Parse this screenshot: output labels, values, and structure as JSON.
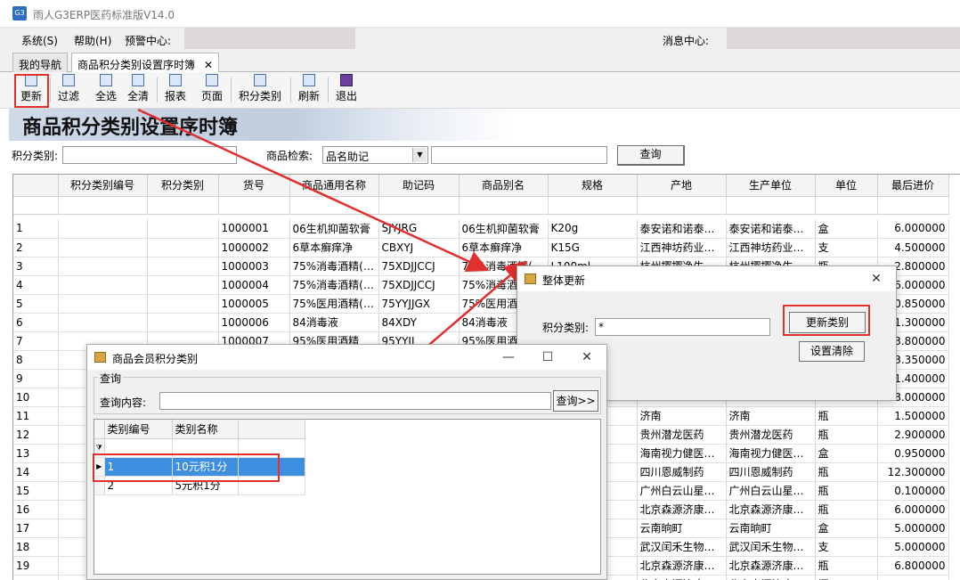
{
  "window": {
    "title": "雨人G3ERP医药标准版V14.0",
    "icon": "app-logo-icon"
  },
  "menu": {
    "items": [
      "系统(S)",
      "帮助(H)",
      "预警中心:"
    ],
    "message_center": "消息中心:"
  },
  "tabs": [
    {
      "label": "我的导航"
    },
    {
      "label": "商品积分类别设置序时簿",
      "close": "✕"
    }
  ],
  "toolbar": {
    "buttons": [
      "更新",
      "过滤",
      "全选",
      "全清",
      "报表",
      "页面",
      "积分类别",
      "刷新",
      "退出"
    ]
  },
  "banner": {
    "title": "商品积分类别设置序时簿"
  },
  "filter": {
    "category_label": "积分类别:",
    "search_label": "商品检索:",
    "search_mode": "品名助记",
    "query_button": "查询"
  },
  "grid": {
    "columns": [
      "",
      "积分类别编号",
      "积分类别",
      "货号",
      "商品通用名称",
      "助记码",
      "商品别名",
      "规格",
      "产地",
      "生产单位",
      "单位",
      "最后进价"
    ],
    "rows": [
      [
        "1",
        "",
        "",
        "1000001",
        "06生机抑菌软膏",
        "SJYJRG",
        "06生机抑菌软膏",
        "K20g",
        "泰安诺和诺泰…",
        "泰安诺和诺泰…",
        "盒",
        "6.000000"
      ],
      [
        "2",
        "",
        "",
        "1000002",
        "6草本癣痒净",
        "CBXYJ",
        "6草本癣痒净",
        "K15G",
        "江西神坊药业…",
        "江西神坊药业…",
        "支",
        "4.500000"
      ],
      [
        "3",
        "",
        "",
        "1000003",
        "75%消毒酒精(…",
        "75XDJJCCJ",
        "75%消毒酒精(…",
        "L100ml",
        "杭州撄撄净生…",
        "杭州撄撄净生…",
        "瓶",
        "2.800000"
      ],
      [
        "4",
        "",
        "",
        "1000004",
        "75%消毒酒精(…",
        "75XDJJCCJ",
        "75%消毒酒精(…",
        "",
        "",
        "",
        "",
        "6.000000"
      ],
      [
        "5",
        "",
        "",
        "1000005",
        "75%医用酒精(…",
        "75YYJJGX",
        "75%医用酒…",
        "",
        "",
        "",
        "",
        "0.850000"
      ],
      [
        "6",
        "",
        "",
        "1000006",
        "84消毒液",
        "84XDY",
        "84消毒液",
        "",
        "",
        "",
        "",
        "1.300000"
      ],
      [
        "7",
        "",
        "",
        "1000007",
        "95%医用酒精",
        "95YYJJ",
        "95%医用酒…",
        "",
        "",
        "",
        "",
        "3.800000"
      ],
      [
        "8",
        "",
        "",
        "",
        "",
        "",
        "",
        "",
        "",
        "",
        "",
        "3.350000"
      ],
      [
        "9",
        "",
        "",
        "",
        "",
        "",
        "",
        "",
        "",
        "",
        "",
        "1.400000"
      ],
      [
        "10",
        "",
        "",
        "",
        "",
        "",
        "",
        "",
        "",
        "",
        "",
        "8.000000"
      ],
      [
        "11",
        "",
        "",
        "",
        "",
        "",
        "",
        "",
        "济南",
        "济南",
        "瓶",
        "1.500000"
      ],
      [
        "12",
        "",
        "",
        "",
        "",
        "",
        "",
        "",
        "贵州潜龙医药",
        "贵州潜龙医药",
        "瓶",
        "2.900000"
      ],
      [
        "13",
        "",
        "",
        "",
        "",
        "",
        "",
        "",
        "海南视力健医…",
        "海南视力健医…",
        "盒",
        "0.950000"
      ],
      [
        "14",
        "",
        "",
        "",
        "",
        "",
        "",
        "",
        "四川恩威制药",
        "四川恩威制药",
        "瓶",
        "12.300000"
      ],
      [
        "15",
        "",
        "",
        "",
        "",
        "",
        "",
        "",
        "广州白云山星…",
        "广州白云山星…",
        "瓶",
        "0.100000"
      ],
      [
        "16",
        "",
        "",
        "",
        "",
        "",
        "",
        "",
        "北京森源济康…",
        "北京森源济康…",
        "瓶",
        "6.000000"
      ],
      [
        "17",
        "",
        "",
        "",
        "",
        "",
        "",
        "",
        "云南晌町",
        "云南晌町",
        "盒",
        "5.000000"
      ],
      [
        "18",
        "",
        "",
        "",
        "",
        "",
        "",
        "",
        "武汉闰禾生物…",
        "武汉闰禾生物…",
        "支",
        "5.000000"
      ],
      [
        "19",
        "",
        "",
        "",
        "",
        "",
        "",
        "",
        "北京森源济康…",
        "北京森源济康…",
        "瓶",
        "6.800000"
      ],
      [
        "20",
        "",
        "",
        "",
        "",
        "",
        "",
        "",
        "北京森源济康…",
        "北京森源济康…",
        "瓶",
        "10.500000"
      ]
    ]
  },
  "update_dialog": {
    "title": "整体更新",
    "category_label": "积分类别:",
    "category_value": "*",
    "update_button": "更新类别",
    "clear_button": "设置清除",
    "close": "✕"
  },
  "member_dialog": {
    "title": "商品会员积分类别",
    "group_label": "查询",
    "query_label": "查询内容:",
    "query_value": "",
    "query_button": "查询>>",
    "columns": [
      "类别编号",
      "类别名称"
    ],
    "rows": [
      [
        "1",
        "10元积1分"
      ],
      [
        "2",
        "5元积1分"
      ]
    ],
    "minimize": "—",
    "maximize": "☐",
    "close": "✕"
  },
  "colors": {
    "highlight_box": "#e03030",
    "selection": "#3f8fe0",
    "arrow": "#e03030"
  }
}
